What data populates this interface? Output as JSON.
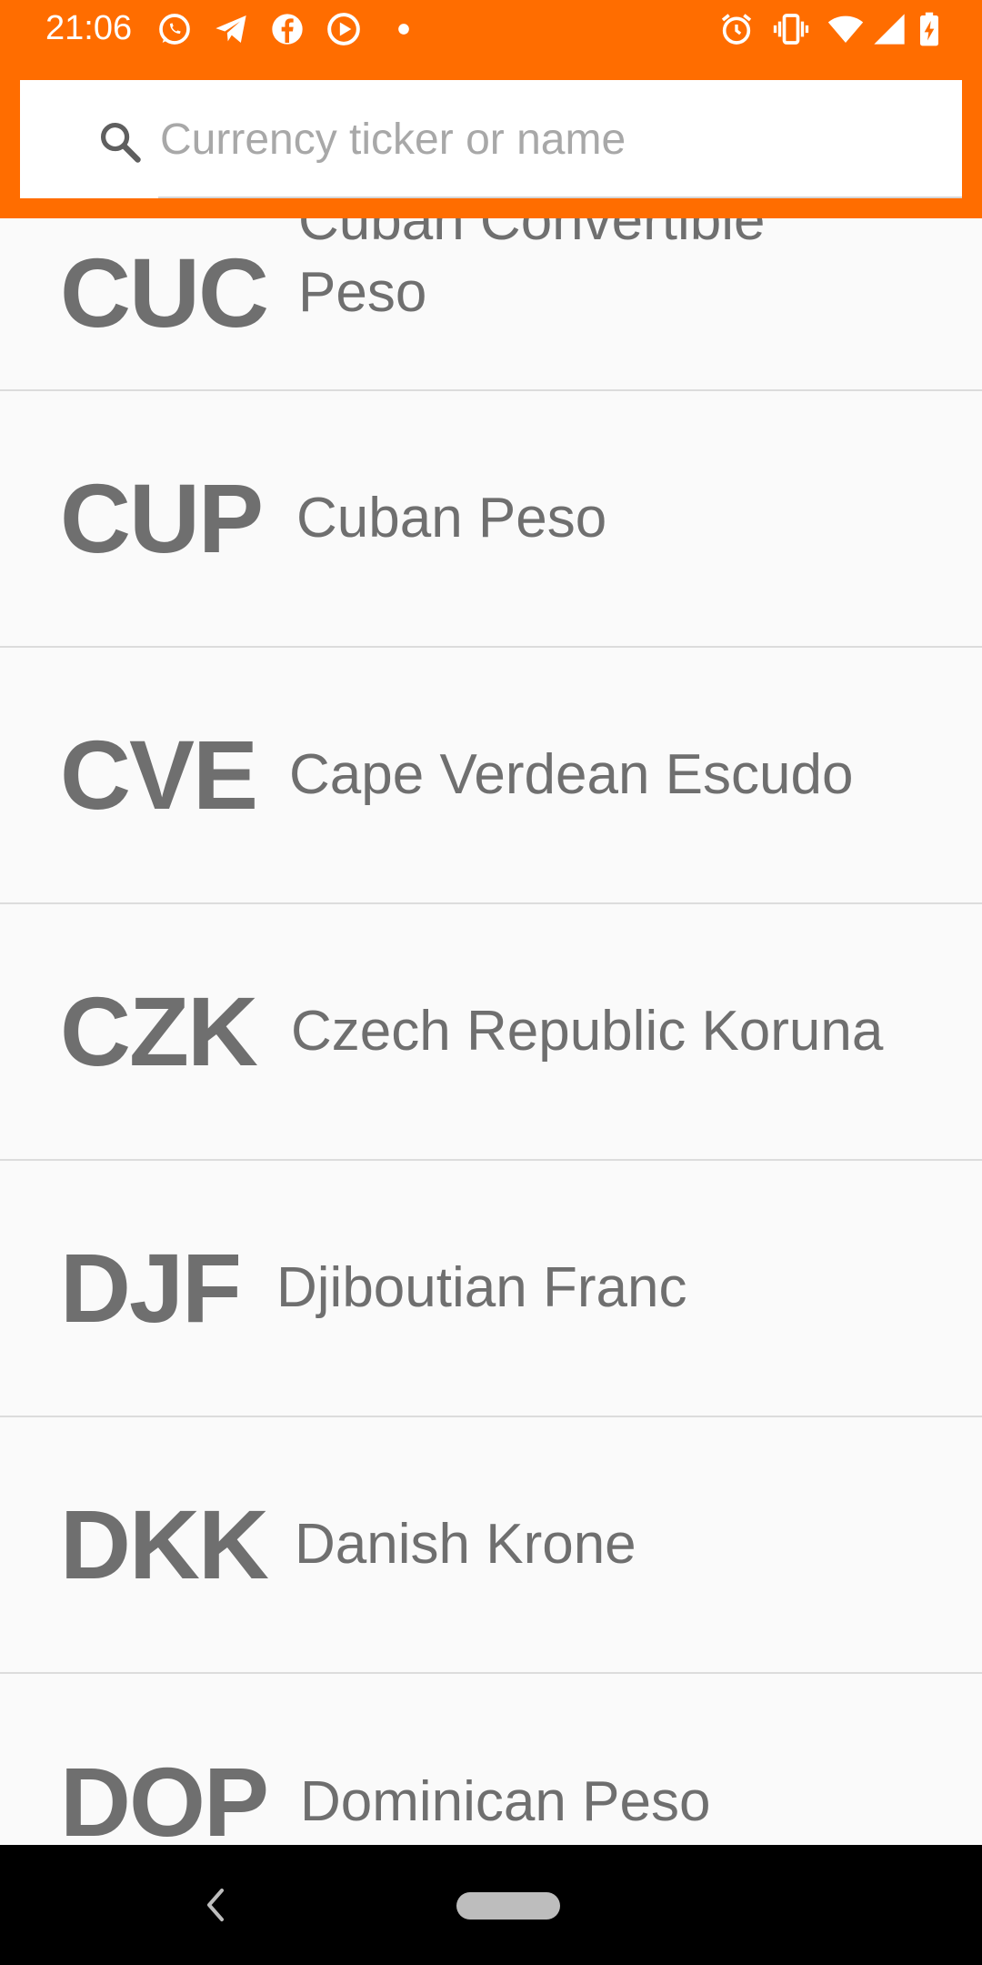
{
  "status_bar": {
    "time": "21:06",
    "left_icons": [
      "whatsapp-icon",
      "telegram-icon",
      "facebook-icon",
      "youtube-icon",
      "notification-dot-icon"
    ],
    "right_icons": [
      "alarm-icon",
      "vibrate-icon",
      "wifi-icon",
      "signal-icon",
      "battery-charging-icon"
    ]
  },
  "search": {
    "placeholder": "Currency ticker or name",
    "value": ""
  },
  "currencies": [
    {
      "ticker": "CUC",
      "name": "Cuban Convertible Peso"
    },
    {
      "ticker": "CUP",
      "name": "Cuban Peso"
    },
    {
      "ticker": "CVE",
      "name": "Cape Verdean Escudo"
    },
    {
      "ticker": "CZK",
      "name": "Czech Republic Koruna"
    },
    {
      "ticker": "DJF",
      "name": "Djiboutian Franc"
    },
    {
      "ticker": "DKK",
      "name": "Danish Krone"
    },
    {
      "ticker": "DOP",
      "name": "Dominican Peso"
    }
  ],
  "colors": {
    "accent": "#ff6d00",
    "text": "#6f6f6f",
    "background": "#fafafa",
    "divider": "#dcdcdc"
  }
}
